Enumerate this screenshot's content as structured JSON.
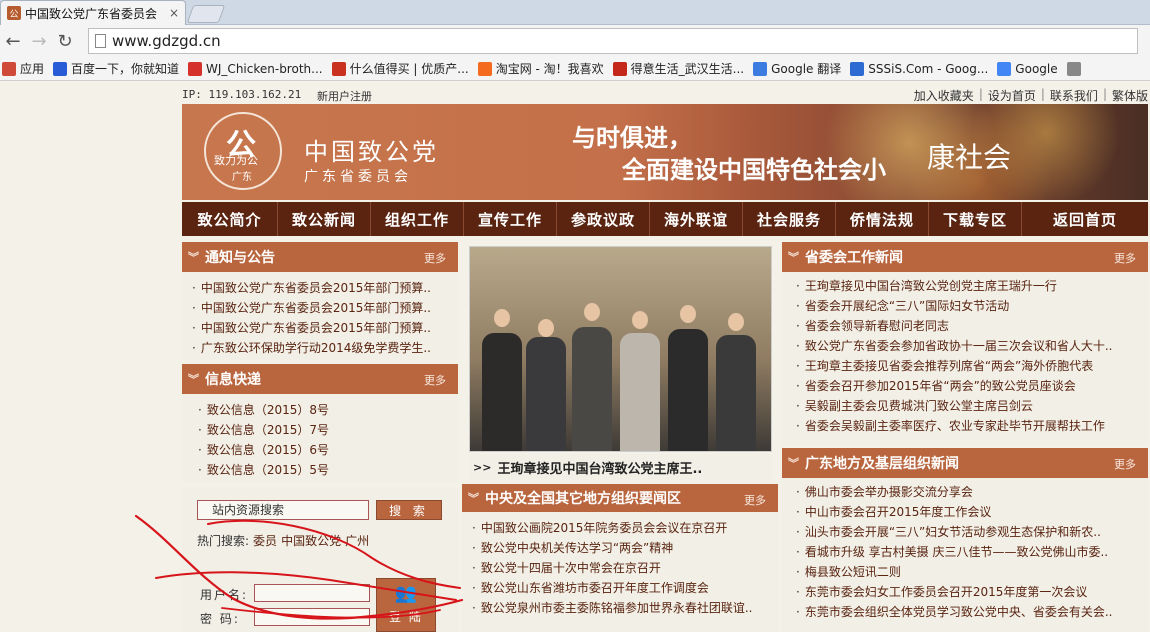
{
  "browser": {
    "tab_title": "中国致公党广东省委员会",
    "tab_close": "×",
    "url": "www.gdzgd.cn",
    "bookmarks": [
      {
        "label": "应用",
        "color": "#d04a3a"
      },
      {
        "label": "百度一下，你就知道",
        "color": "#2a5bd7"
      },
      {
        "label": "WJ_Chicken-broth...",
        "color": "#d6302c"
      },
      {
        "label": "什么值得买 | 优质产...",
        "color": "#c8321f"
      },
      {
        "label": "淘宝网 - 淘！我喜欢",
        "color": "#f46a1f"
      },
      {
        "label": "得意生活_武汉生活...",
        "color": "#c4281b"
      },
      {
        "label": "Google 翻译",
        "color": "#3c7be0"
      },
      {
        "label": "SSSiS.Com - Goog...",
        "color": "#2d6bd3"
      },
      {
        "label": "Google",
        "color": "#4285f4"
      },
      {
        "label": "",
        "color": "#888888"
      }
    ]
  },
  "site": {
    "ip": "IP: 119.103.162.21",
    "register": "新用户注册",
    "toplinks": [
      "加入收藏夹",
      "设为首页",
      "联系我们",
      "繁体版"
    ],
    "logo_char": "公",
    "logo_motto": "致力为公",
    "logo_gd": "广东",
    "org_name": "中国致公党",
    "org_sub": "广东省委员会",
    "slogan_1": "与时俱进，",
    "slogan_2": "全面建设中国特色社会小",
    "slogan_3": "康社会",
    "nav": [
      "致公简介",
      "致公新闻",
      "组织工作",
      "宣传工作",
      "参政议政",
      "海外联谊",
      "社会服务",
      "侨情法规",
      "下载专区",
      "返回首页"
    ],
    "more": "更多",
    "notices": {
      "title": "通知与公告",
      "items": [
        "中国致公党广东省委员会2015年部门预算..",
        "中国致公党广东省委员会2015年部门预算..",
        "中国致公党广东省委员会2015年部门预算..",
        "广东致公环保助学行动2014级免学费学生.."
      ]
    },
    "info": {
      "title": "信息快递",
      "items": [
        "致公信息（2015）8号",
        "致公信息（2015）7号",
        "致公信息（2015）6号",
        "致公信息（2015）5号"
      ]
    },
    "photo_caption": "王珣章接见中国台湾致公党主席王..",
    "central": {
      "title": "中央及全国其它地方组织要闻区",
      "items": [
        "中国致公画院2015年院务委员会会议在京召开",
        "致公党中央机关传达学习“两会”精神",
        "致公党十四届十次中常会在京召开",
        "致公党山东省潍坊市委召开年度工作调度会",
        "致公党泉州市委主委陈铭福参加世界永春社团联谊.."
      ]
    },
    "province": {
      "title": "省委会工作新闻",
      "items": [
        "王珣章接见中国台湾致公党创党主席王瑞升一行",
        "省委会开展纪念“三八”国际妇女节活动",
        "省委会领导新春慰问老同志",
        "致公党广东省委会参加省政协十一届三次会议和省人大十..",
        "王珣章主委接见省委会推荐列席省“两会”海外侨胞代表",
        "省委会召开参加2015年省“两会”的致公党员座谈会",
        "吴毅副主委会见费城洪门致公堂主席吕剑云",
        "省委会吴毅副主委率医疗、农业专家赴毕节开展帮扶工作"
      ]
    },
    "local": {
      "title": "广东地方及基层组织新闻",
      "items": [
        "佛山市委会举办摄影交流分享会",
        "中山市委会召开2015年度工作会议",
        "汕头市委会开展“三八”妇女节活动参观生态保护和新农..",
        "看城市升级 享古村美摄 庆三八佳节——致公党佛山市委..",
        "梅县致公短讯二则",
        "东莞市委会妇女工作委员会召开2015年度第一次会议",
        "东莞市委会组织全体党员学习致公党中央、省委会有关会.."
      ]
    },
    "search": {
      "placeholder": "站内资源搜索",
      "button": "搜 索",
      "hot_label": "热门搜索:",
      "hot_terms": [
        "委员",
        "中国致公党",
        "广州"
      ]
    },
    "login": {
      "username_label": "用户名:",
      "password_label": "密  码:",
      "button": "登 陆"
    }
  },
  "colors": {
    "accent": "#b9663f",
    "nav_bg": "#5a2411",
    "panel_bg": "#f1efe6",
    "annotation": "#d7141a"
  }
}
